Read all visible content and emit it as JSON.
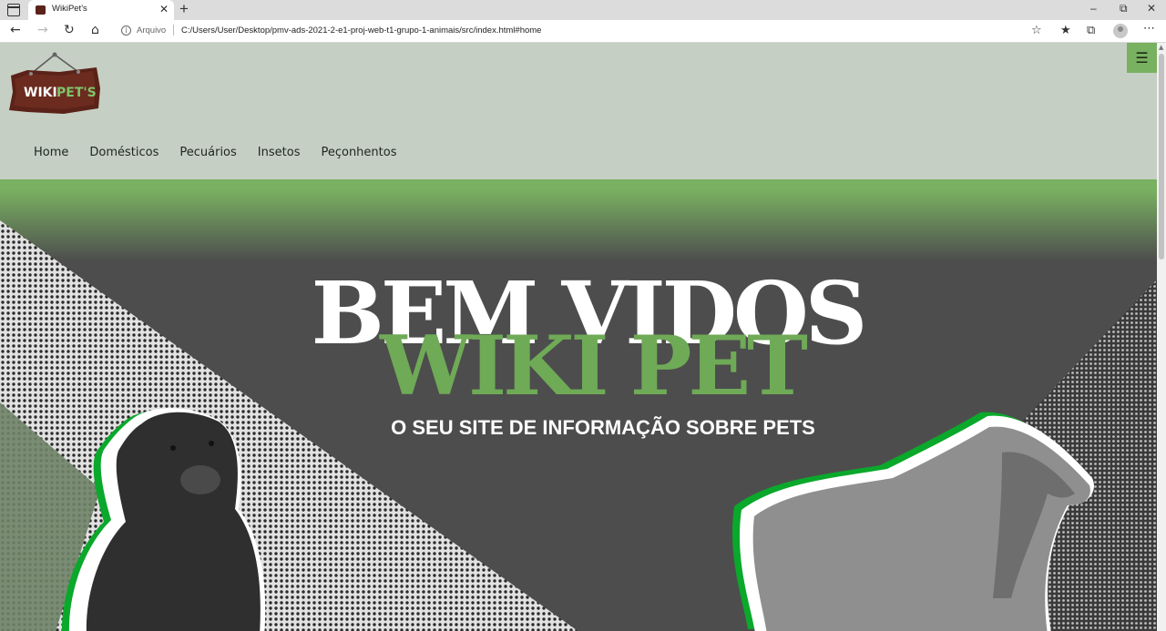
{
  "browser": {
    "tab_title": "WikiPet's",
    "tab_close": "✕",
    "new_tab": "+",
    "address": {
      "scheme_label": "Arquivo",
      "url": "C:/Users/User/Desktop/pmv-ads-2021-2-e1-proj-web-t1-grupo-1-animais/src/index.html#home"
    },
    "icons": [
      "back-icon",
      "forward-icon",
      "refresh-icon",
      "home-icon",
      "info-icon",
      "favorite-add-icon",
      "favorites-icon",
      "collections-icon",
      "profile-icon",
      "more-icon"
    ],
    "window_controls": [
      "minimize-icon",
      "restore-icon",
      "close-icon"
    ]
  },
  "site": {
    "logo_text_1": "WIKI",
    "logo_text_2": "PET'S",
    "menu_icon": "hamburger-menu-icon",
    "nav": [
      "Home",
      "Domésticos",
      "Pecuários",
      "Insetos",
      "Peçonhentos"
    ],
    "hero": {
      "title_line_1": "BEM VIDOS",
      "title_line_2": "WIKI PET",
      "subtitle": "O SEU SITE DE INFORMAÇÃO SOBRE PETS"
    }
  },
  "colors": {
    "page_bg": "#c6cfc3",
    "accent_green": "#78b160",
    "hero_dark": "#4d4d4d",
    "logo_wood": "#5a2218"
  }
}
